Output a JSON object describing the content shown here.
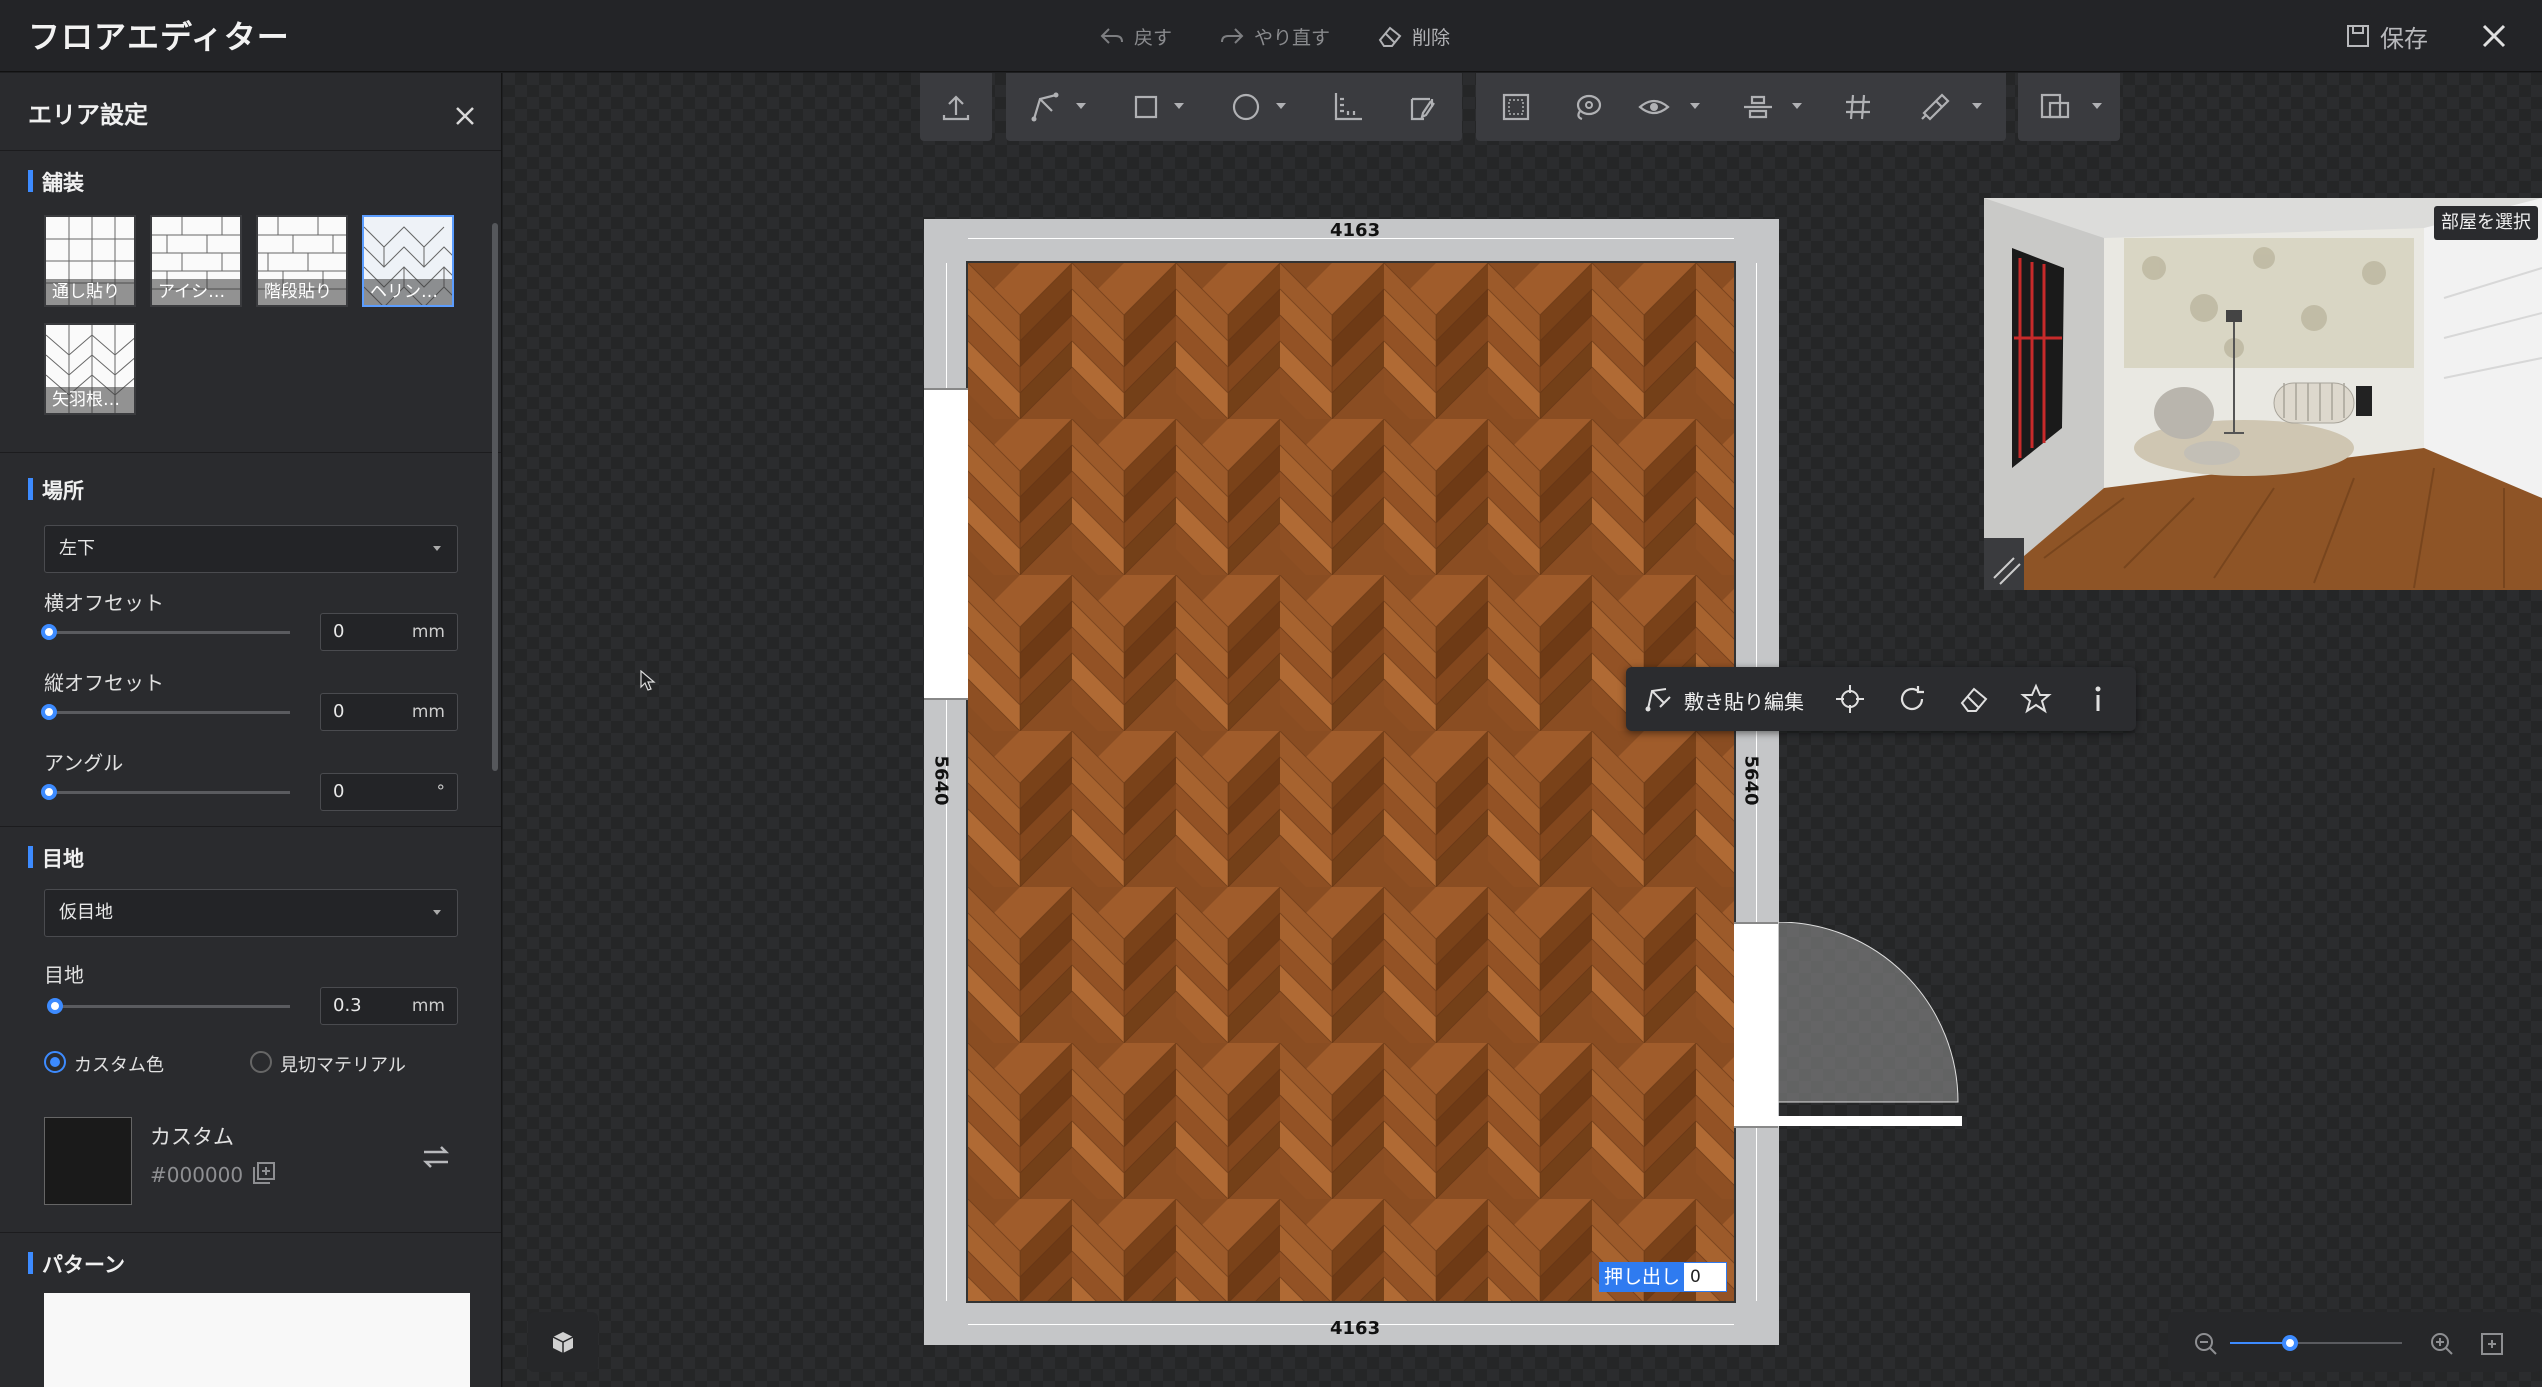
{
  "header": {
    "title": "フロアエディター",
    "undo_label": "戻す",
    "redo_label": "やり直す",
    "delete_label": "削除",
    "save_label": "保存"
  },
  "panel": {
    "title": "エリア設定",
    "paving": {
      "title": "舗装",
      "tiles": [
        {
          "label": "通し貼り",
          "icon": "grid-pattern-icon",
          "selected": false
        },
        {
          "label": "アイシ…",
          "icon": "brick-pattern-icon",
          "selected": false
        },
        {
          "label": "階段貼り",
          "icon": "stair-pattern-icon",
          "selected": false
        },
        {
          "label": "ヘリン…",
          "icon": "herringbone-pattern-icon",
          "selected": true
        },
        {
          "label": "矢羽根…",
          "icon": "chevron-pattern-icon",
          "selected": false
        }
      ]
    },
    "location": {
      "title": "場所",
      "selected": "左下",
      "h_offset_label": "横オフセット",
      "h_offset_value": "0",
      "v_offset_label": "縦オフセット",
      "v_offset_value": "0",
      "angle_label": "アングル",
      "angle_value": "0",
      "unit_mm": "mm",
      "unit_deg": "°"
    },
    "joint": {
      "title": "目地",
      "selected": "仮目地",
      "width_label": "目地",
      "width_value": "0.3",
      "radio_custom": "カスタム色",
      "radio_material": "見切マテリアル",
      "color_name": "カスタム",
      "color_hex": "#000000"
    },
    "pattern": {
      "title": "パターン"
    }
  },
  "canvas": {
    "dim_top": "4163",
    "dim_bottom": "4163",
    "dim_left": "5640",
    "dim_right": "5640",
    "edit_toolbar_label": "敷き貼り編集",
    "extrude_label": "押し出し",
    "extrude_value": "0",
    "preview_button": "部屋を選択",
    "zoom_level": 0.35
  },
  "colors": {
    "accent": "#3d8bff",
    "floor_wood": "#8a4d22",
    "panel_bg": "#2a2b2e"
  }
}
